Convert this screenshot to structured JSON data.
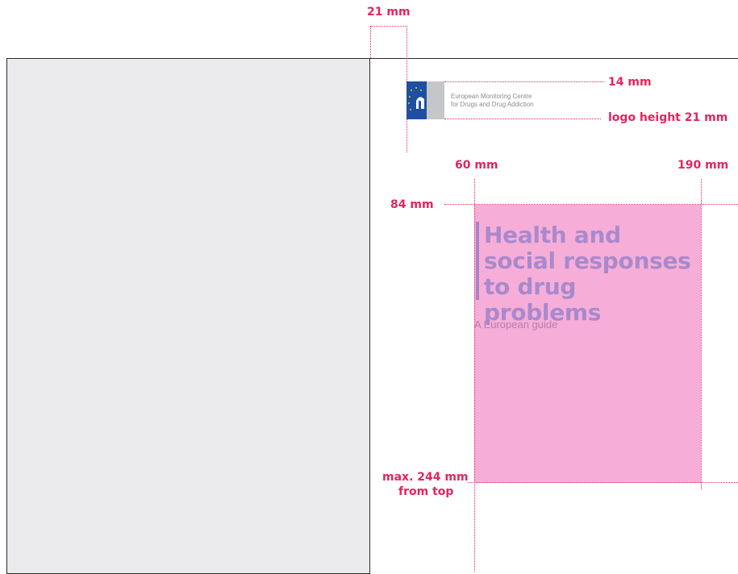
{
  "dimensions": {
    "margin_width": "21 mm",
    "logo_top": "14 mm",
    "logo_height": "logo height 21 mm",
    "title_left": "60 mm",
    "title_right": "190 mm",
    "title_top": "84 mm",
    "max_bottom_line1": "max. 244 mm",
    "max_bottom_line2": "from top"
  },
  "logo": {
    "text": "European Monitoring Centre\nfor Drugs and Drug Addiction"
  },
  "cover": {
    "title": "Health and social responses to drug problems",
    "subtitle": "A European guide"
  },
  "colors": {
    "dimension_accent": "#e5245c",
    "title_area": "#f6aed9",
    "title_text": "#a989cc",
    "logo_blue": "#1f4fa0",
    "back_page": "#ebebed"
  }
}
